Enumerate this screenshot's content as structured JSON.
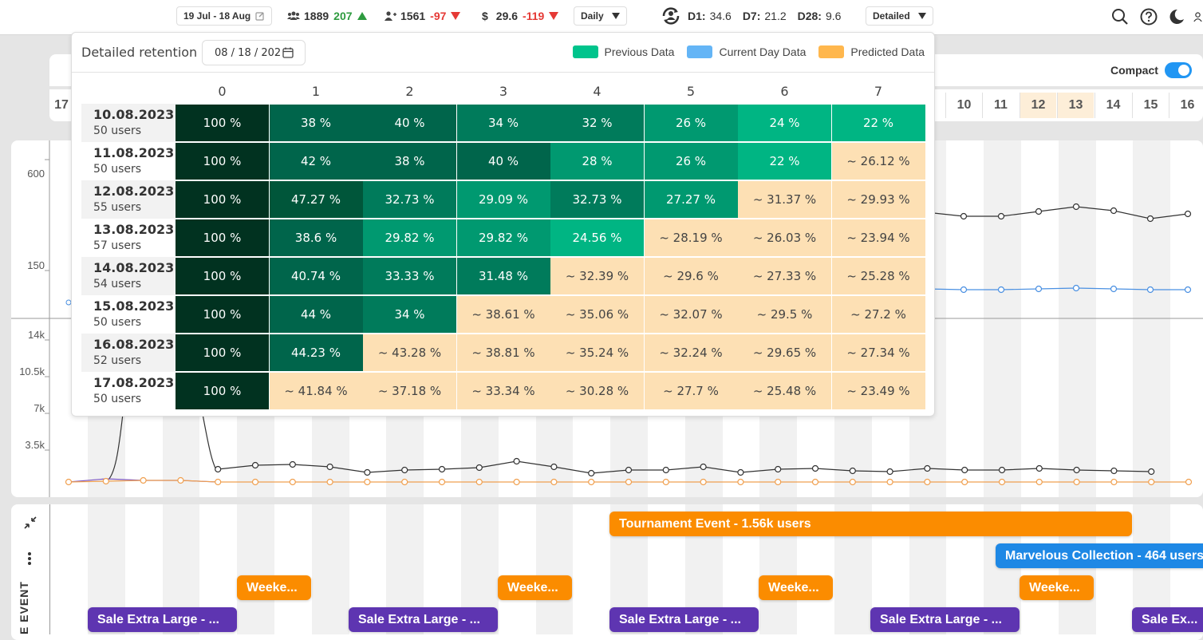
{
  "topbar": {
    "date_range": "19 Jul - 18 Aug",
    "users_total": "1889",
    "users_delta": "207",
    "new_users_total": "1561",
    "new_users_delta": "-97",
    "revenue_symbol": "$",
    "revenue_total": "29.6",
    "revenue_delta": "-119",
    "granularity": "Daily",
    "d1_label": "D1:",
    "d1_value": "34.6",
    "d7_label": "D7:",
    "d7_value": "21.2",
    "d28_label": "D28:",
    "d28_value": "9.6",
    "retention_mode": "Detailed"
  },
  "popup": {
    "title": "Detailed retention",
    "date_value": "08 / 18 / 202",
    "legend": [
      {
        "label": "Previous Data",
        "color": "#00c48c"
      },
      {
        "label": "Current Day Data",
        "color": "#64b5f6"
      },
      {
        "label": "Predicted Data",
        "color": "#ffb74d"
      }
    ],
    "columns": [
      "0",
      "1",
      "2",
      "3",
      "4",
      "5",
      "6",
      "7"
    ],
    "rows": [
      {
        "date": "10.08.2023",
        "users": "50 users",
        "cells": [
          "100 %",
          "38 %",
          "40 %",
          "34 %",
          "32 %",
          "26 %",
          "24 %",
          "22 %"
        ],
        "predicted_from": 8
      },
      {
        "date": "11.08.2023",
        "users": "50 users",
        "cells": [
          "100 %",
          "42 %",
          "38 %",
          "40 %",
          "28 %",
          "26 %",
          "22 %",
          "~ 26.12 %"
        ],
        "predicted_from": 7
      },
      {
        "date": "12.08.2023",
        "users": "55 users",
        "cells": [
          "100 %",
          "47.27 %",
          "32.73 %",
          "29.09 %",
          "32.73 %",
          "27.27 %",
          "~ 31.37 %",
          "~ 29.93 %"
        ],
        "predicted_from": 6
      },
      {
        "date": "13.08.2023",
        "users": "57 users",
        "cells": [
          "100 %",
          "38.6 %",
          "29.82 %",
          "29.82 %",
          "24.56 %",
          "~ 28.19 %",
          "~ 26.03 %",
          "~ 23.94 %"
        ],
        "predicted_from": 5
      },
      {
        "date": "14.08.2023",
        "users": "54 users",
        "cells": [
          "100 %",
          "40.74 %",
          "33.33 %",
          "31.48 %",
          "~ 32.39 %",
          "~ 29.6 %",
          "~ 27.33 %",
          "~ 25.28 %"
        ],
        "predicted_from": 4
      },
      {
        "date": "15.08.2023",
        "users": "50 users",
        "cells": [
          "100 %",
          "44 %",
          "34 %",
          "~ 38.61 %",
          "~ 35.06 %",
          "~ 32.07 %",
          "~ 29.5 %",
          "~ 27.2 %"
        ],
        "predicted_from": 3
      },
      {
        "date": "16.08.2023",
        "users": "52 users",
        "cells": [
          "100 %",
          "44.23 %",
          "~ 43.28 %",
          "~ 38.81 %",
          "~ 35.24 %",
          "~ 32.24 %",
          "~ 29.65 %",
          "~ 27.34 %"
        ],
        "predicted_from": 2
      },
      {
        "date": "17.08.2023",
        "users": "50 users",
        "cells": [
          "100 %",
          "~ 41.84 %",
          "~ 37.18 %",
          "~ 33.34 %",
          "~ 30.28 %",
          "~ 27.7 %",
          "~ 25.48 %",
          "~ 23.49 %"
        ],
        "predicted_from": 1
      }
    ],
    "colors": {
      "day0": "#013220",
      "predicted": "#fde0b4"
    }
  },
  "compact": {
    "label": "Compact",
    "on": true
  },
  "day_tabs": [
    "10",
    "11",
    "12",
    "13",
    "14",
    "15",
    "16"
  ],
  "day_tabs_partial_left": "17",
  "axis_top": [
    "600",
    "150"
  ],
  "axis_bottom": [
    "14k",
    "10.5k",
    "7k",
    "3.5k"
  ],
  "events": {
    "section_label": "E EVENT",
    "items": [
      {
        "label": "Tournament Event - 1.56k users",
        "type": "orange"
      },
      {
        "label": "Marvelous Collection - 464 users",
        "type": "blue"
      },
      {
        "label": "Weeke...",
        "type": "orange"
      },
      {
        "label": "Weeke...",
        "type": "orange"
      },
      {
        "label": "Weeke...",
        "type": "orange"
      },
      {
        "label": "Weeke...",
        "type": "orange"
      },
      {
        "label": "Sale Extra Large - ...",
        "type": "purple"
      },
      {
        "label": "Sale Extra Large - ...",
        "type": "purple"
      },
      {
        "label": "Sale Extra Large - ...",
        "type": "purple"
      },
      {
        "label": "Sale Extra Large - ...",
        "type": "purple"
      },
      {
        "label": "Sale Ex...",
        "type": "purple"
      }
    ]
  }
}
